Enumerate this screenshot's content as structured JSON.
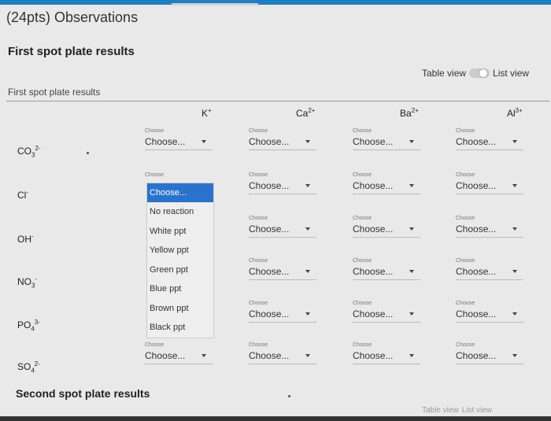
{
  "header": {
    "title": "(24pts) Observations",
    "subtitle": "First spot plate results"
  },
  "view_toggle": {
    "table_label": "Table view",
    "list_label": "List view"
  },
  "table": {
    "caption": "First spot plate results",
    "columns": [
      {
        "base": "K",
        "sup": "+"
      },
      {
        "base": "Ca",
        "sup": "2+"
      },
      {
        "base": "Ba",
        "sup": "2+"
      },
      {
        "base": "Al",
        "sup": "3+"
      }
    ],
    "rows": [
      {
        "base": "CO",
        "sub": "3",
        "sup": "2-"
      },
      {
        "base": "Cl",
        "sub": "",
        "sup": "-"
      },
      {
        "base": "OH",
        "sub": "",
        "sup": "-"
      },
      {
        "base": "NO",
        "sub": "3",
        "sup": "-"
      },
      {
        "base": "PO",
        "sub": "4",
        "sup": "3-"
      },
      {
        "base": "SO",
        "sub": "4",
        "sup": "2-"
      }
    ],
    "select_small_label": "Choose",
    "select_value": "Choose..."
  },
  "dropdown": {
    "selected": "Choose...",
    "options": [
      "No reaction",
      "White ppt",
      "Yellow ppt",
      "Green ppt",
      "Blue ppt",
      "Brown ppt",
      "Black ppt"
    ]
  },
  "second_section": {
    "title": "Second spot plate results"
  },
  "bottom_toggle": {
    "table_label": "Table view",
    "list_label": "List view"
  }
}
